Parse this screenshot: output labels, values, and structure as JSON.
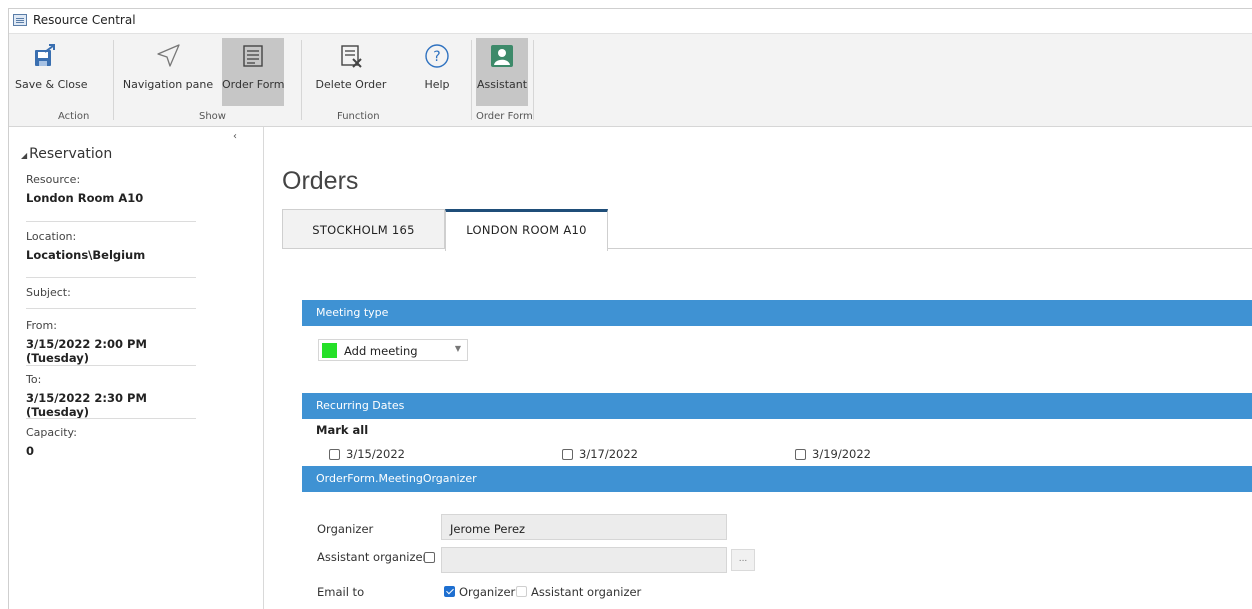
{
  "window": {
    "title": "Resource Central"
  },
  "ribbon": {
    "buttons": [
      {
        "label": "Save & Close",
        "icon": "save-close-icon"
      },
      {
        "label": "Navigation pane",
        "icon": "navigation-arrow-icon"
      },
      {
        "label": "Order Form",
        "icon": "order-form-icon",
        "active": true
      },
      {
        "label": "Delete Order",
        "icon": "delete-order-icon"
      },
      {
        "label": "Help",
        "icon": "help-icon"
      },
      {
        "label": "Assistant",
        "icon": "assistant-icon",
        "active": true
      }
    ],
    "groups": [
      "Action",
      "Show",
      "Function",
      "Order Form"
    ]
  },
  "sidebar": {
    "collapse_glyph": "‹",
    "section_title": "Reservation",
    "fields": [
      {
        "label": "Resource:",
        "value": "London Room A10"
      },
      {
        "label": "Location:",
        "value": "Locations\\Belgium"
      },
      {
        "label": "Subject:",
        "value": ""
      },
      {
        "label": "From:",
        "value": "3/15/2022 2:00 PM (Tuesday)"
      },
      {
        "label": "To:",
        "value": "3/15/2022 2:30 PM (Tuesday)"
      },
      {
        "label": "Capacity:",
        "value": "0"
      }
    ]
  },
  "main": {
    "heading": "Orders",
    "tabs": [
      {
        "label": "STOCKHOLM 165",
        "active": false
      },
      {
        "label": "LONDON ROOM A10",
        "active": true
      }
    ],
    "meeting_type": {
      "header": "Meeting type",
      "selected": "Add meeting",
      "swatch_color": "#25e028"
    },
    "recurring": {
      "header": "Recurring Dates",
      "mark_all": "Mark all",
      "dates": [
        "3/15/2022",
        "3/17/2022",
        "3/19/2022"
      ]
    },
    "organizer": {
      "header": "OrderForm.MeetingOrganizer",
      "organizer_label": "Organizer",
      "organizer_value": "Jerome Perez",
      "assistant_label": "Assistant organizer",
      "browse_glyph": "...",
      "email_label": "Email to",
      "email_options": [
        {
          "label": "Organizer",
          "checked": true
        },
        {
          "label": "Assistant organizer",
          "checked": false
        }
      ]
    }
  },
  "colors": {
    "accent_band": "#3f92d3",
    "tab_active_border": "#1f4e79",
    "ribbon_bg": "#f3f3f3"
  }
}
